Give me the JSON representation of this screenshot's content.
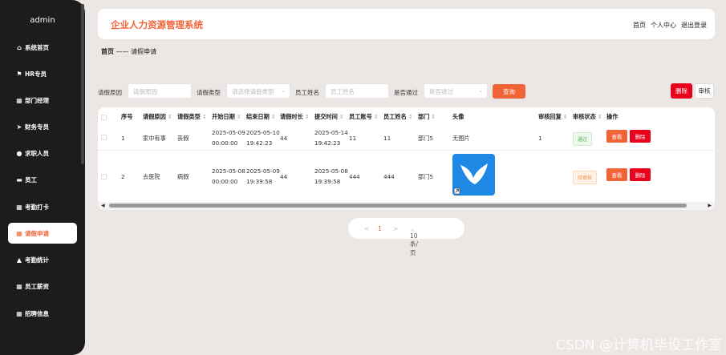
{
  "sidebar": {
    "user": "admin",
    "items": [
      {
        "label": "系统首页",
        "icon": "home-icon"
      },
      {
        "label": "HR专员",
        "icon": "flag-icon"
      },
      {
        "label": "部门经理",
        "icon": "grid-icon"
      },
      {
        "label": "财务专员",
        "icon": "send-icon"
      },
      {
        "label": "求职人员",
        "icon": "person-icon"
      },
      {
        "label": "员工",
        "icon": "chat-icon"
      },
      {
        "label": "考勤打卡",
        "icon": "grid-icon"
      },
      {
        "label": "请假申请",
        "icon": "grid-icon"
      },
      {
        "label": "考勤统计",
        "icon": "thumb-icon"
      },
      {
        "label": "员工薪资",
        "icon": "grid-icon"
      },
      {
        "label": "招聘信息",
        "icon": "grid-icon"
      }
    ]
  },
  "header": {
    "title": "企业人力资源管理系统",
    "link_home": "首页",
    "link_profile": "个人中心",
    "link_logout": "退出登录"
  },
  "breadcrumb": {
    "home": "首页",
    "sep": "——",
    "current": "请假申请"
  },
  "filters": {
    "reason_label": "请假原因",
    "reason_placeholder": "请假原因",
    "type_label": "请假类型",
    "type_placeholder": "请选择请假类型",
    "name_label": "员工姓名",
    "name_placeholder": "员工姓名",
    "pass_label": "是否通过",
    "pass_placeholder": "是否通过",
    "query": "查询",
    "delete": "删除",
    "audit": "审核"
  },
  "table": {
    "headers": [
      "序号",
      "请假原因",
      "请假类型",
      "开始日期",
      "结束日期",
      "请假时长",
      "提交时间",
      "员工账号",
      "员工姓名",
      "部门",
      "头像",
      "审核回复",
      "审核状态",
      "操作"
    ],
    "rows": [
      {
        "index": "1",
        "reason": "家中有事",
        "type": "丧假",
        "start_date": "2025-05-09",
        "start_time": "00:00:00",
        "end_date": "2025-05-10",
        "end_time": "19:42:23",
        "duration": "44",
        "submit_date": "2025-05-14",
        "submit_time": "19:42:23",
        "account": "11",
        "name": "11",
        "dept": "部门5",
        "avatar": "无图片",
        "reply": "1",
        "status": "通过",
        "view": "查看",
        "delete": "删除"
      },
      {
        "index": "2",
        "reason": "去医院",
        "type": "病假",
        "start_date": "2025-05-08",
        "start_time": "00:00:00",
        "end_date": "2025-05-09",
        "end_time": "19:39:58",
        "duration": "44",
        "submit_date": "2025-05-08",
        "submit_time": "19:39:58",
        "account": "444",
        "name": "444",
        "dept": "部门5",
        "avatar": "",
        "reply": "",
        "status": "待审核",
        "view": "查看",
        "delete": "删除"
      }
    ]
  },
  "pagination": {
    "prev": "<",
    "page": "1",
    "next": ">",
    "size": "10条/页"
  },
  "watermark": "CSDN @计算机毕设工作室",
  "colors": {
    "accent": "#f06438",
    "danger": "#e8001c",
    "sidebar": "#1c1c1c"
  }
}
